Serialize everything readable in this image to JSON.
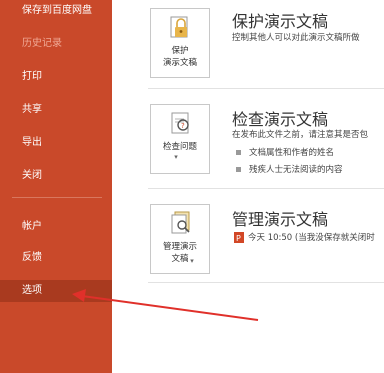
{
  "sidebar": {
    "items": [
      {
        "label": "保存到百度网盘"
      },
      {
        "label": "历史记录"
      },
      {
        "label": "打印"
      },
      {
        "label": "共享"
      },
      {
        "label": "导出"
      },
      {
        "label": "关闭"
      },
      {
        "label": "帐户"
      },
      {
        "label": "反馈"
      },
      {
        "label": "选项"
      }
    ]
  },
  "protect": {
    "button_line1": "保护",
    "button_line2": "演示文稿",
    "title": "保护演示文稿",
    "desc": "控制其他人可以对此演示文稿所做"
  },
  "inspect": {
    "button_line1": "检查问题",
    "title": "检查演示文稿",
    "desc": "在发布此文件之前，请注意其是否包",
    "bullets": [
      "文档属性和作者的姓名",
      "残疾人士无法阅读的内容"
    ]
  },
  "manage": {
    "button_line1": "管理演示",
    "button_line2": "文稿",
    "title": "管理演示文稿",
    "version": "今天 10:50 (当我没保存就关闭时"
  },
  "colors": {
    "sidebar_bg": "#c9492a",
    "arrow": "#e0302a"
  }
}
